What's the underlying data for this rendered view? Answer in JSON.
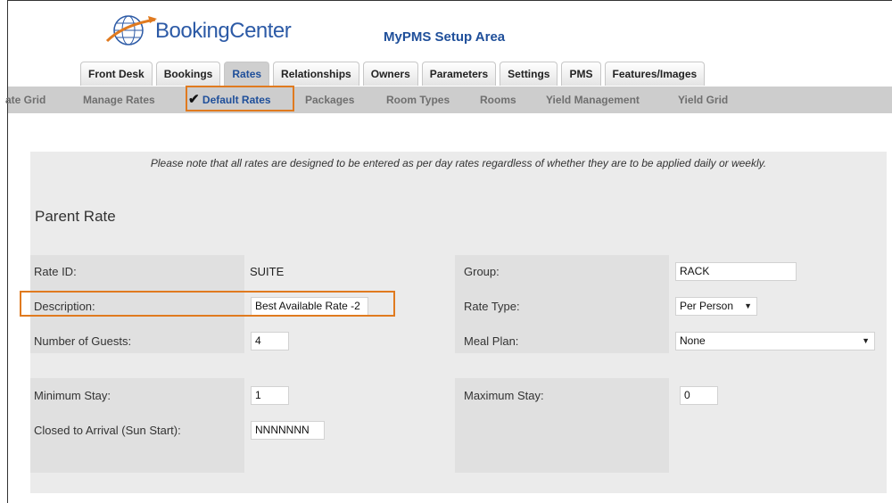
{
  "header": {
    "brand": "BookingCenter",
    "app_title": "MyPMS Setup Area"
  },
  "tabs": [
    {
      "label": "Front Desk"
    },
    {
      "label": "Bookings"
    },
    {
      "label": "Rates",
      "active": true
    },
    {
      "label": "Relationships"
    },
    {
      "label": "Owners"
    },
    {
      "label": "Parameters"
    },
    {
      "label": "Settings"
    },
    {
      "label": "PMS"
    },
    {
      "label": "Features/Images"
    }
  ],
  "subnav": {
    "rate_grid": "ate Grid",
    "manage_rates": "Manage Rates",
    "check": "✔",
    "default_rates": "Default Rates",
    "packages": "Packages",
    "room_types": "Room Types",
    "rooms": "Rooms",
    "yield_management": "Yield Management",
    "yield_grid": "Yield Grid"
  },
  "note": "Please note that all rates are designed to be entered as per day rates regardless of whether they are to be applied daily or weekly.",
  "section_title": "Parent Rate",
  "form": {
    "rate_id_label": "Rate ID:",
    "rate_id_value": "SUITE",
    "description_label": "Description:",
    "description_value": "Best Available Rate -2",
    "guests_label": "Number of Guests:",
    "guests_value": "4",
    "group_label": "Group:",
    "group_value": "RACK",
    "rate_type_label": "Rate Type:",
    "rate_type_value": "Per Person",
    "meal_plan_label": "Meal Plan:",
    "meal_plan_value": "None",
    "min_stay_label": "Minimum Stay:",
    "min_stay_value": "1",
    "max_stay_label": "Maximum Stay:",
    "max_stay_value": "0",
    "cta_label": "Closed to Arrival (Sun Start):",
    "cta_value": "NNNNNNN"
  },
  "colors": {
    "highlight": "#e07a1f",
    "accent": "#1f4f9a"
  }
}
